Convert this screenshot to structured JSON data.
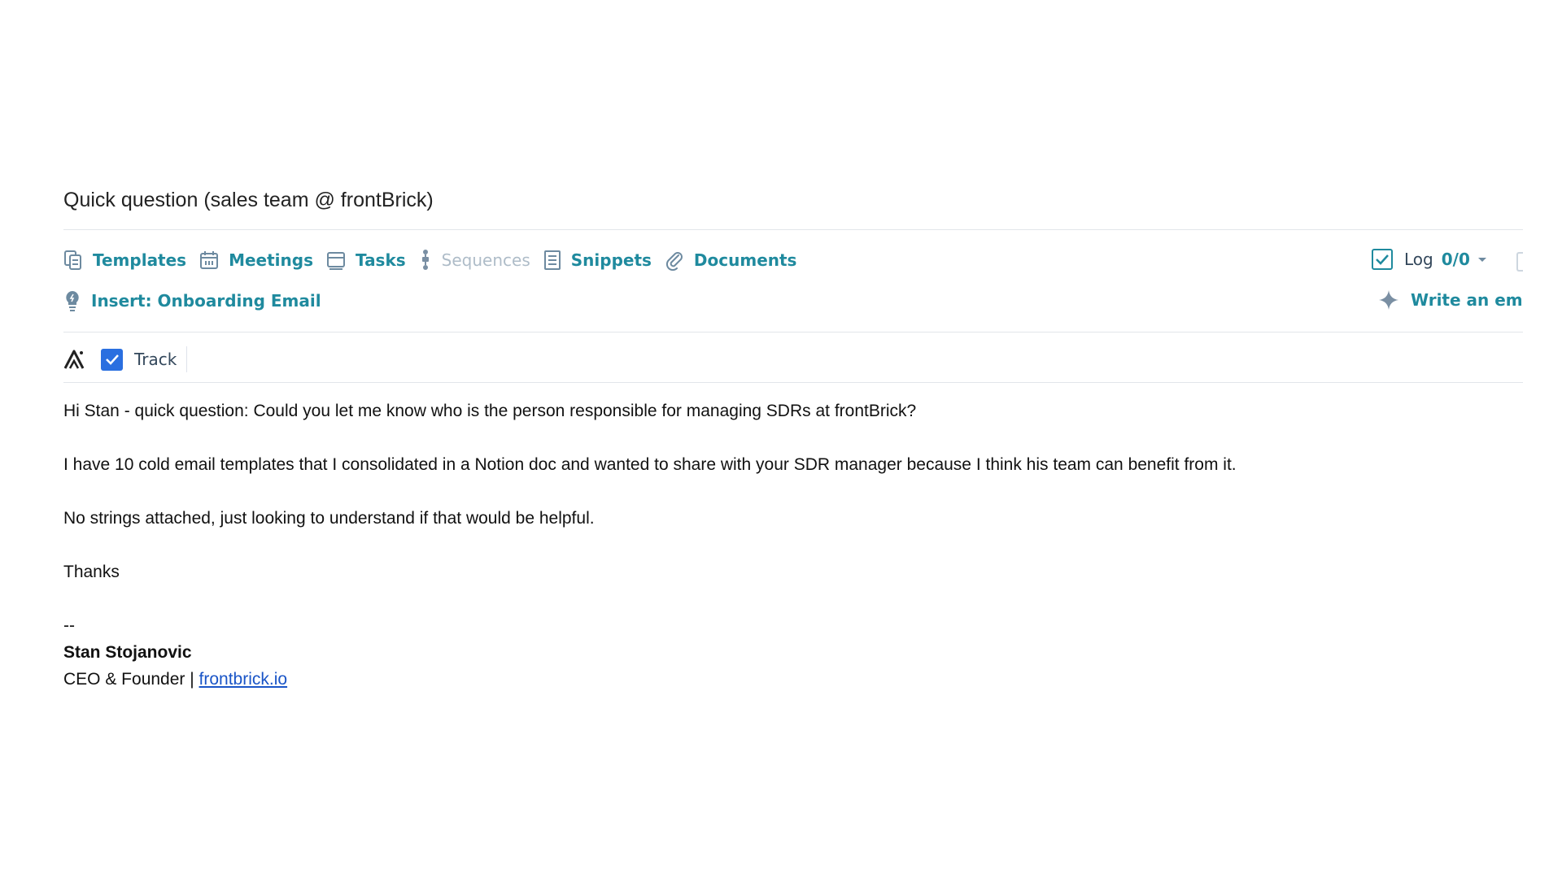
{
  "subject": "Quick question (sales team @ frontBrick)",
  "toolbar": {
    "items": [
      {
        "label": "Templates",
        "icon": "templates-icon",
        "enabled": true
      },
      {
        "label": "Meetings",
        "icon": "calendar-icon",
        "enabled": true
      },
      {
        "label": "Tasks",
        "icon": "tasks-icon",
        "enabled": true
      },
      {
        "label": "Sequences",
        "icon": "sequences-icon",
        "enabled": false
      },
      {
        "label": "Snippets",
        "icon": "snippets-icon",
        "enabled": true
      },
      {
        "label": "Documents",
        "icon": "paperclip-icon",
        "enabled": true
      }
    ],
    "log_label": "Log",
    "log_count": "0/0",
    "insert_label": "Insert: Onboarding Email",
    "write_ai_label": "Write an ema"
  },
  "track": {
    "label": "Track",
    "checked": true
  },
  "email": {
    "line1": "Hi Stan - quick question: Could you let me know who is the person responsible for managing SDRs at frontBrick?",
    "line2": "I have 10 cold email templates that I consolidated in a Notion doc and wanted to share with your SDR manager because I think his team can benefit from it.",
    "line3": "No strings attached, just looking to understand if that would be helpful.",
    "line4": "Thanks",
    "signature_dashes": "--",
    "signature_name": "Stan Stojanovic",
    "signature_title": "CEO & Founder | ",
    "signature_link": "frontbrick.io"
  },
  "colors": {
    "accent": "#1f8a9e",
    "disabled": "#aebcc8",
    "checkbox": "#2a6fe0",
    "link": "#1a55c7"
  }
}
